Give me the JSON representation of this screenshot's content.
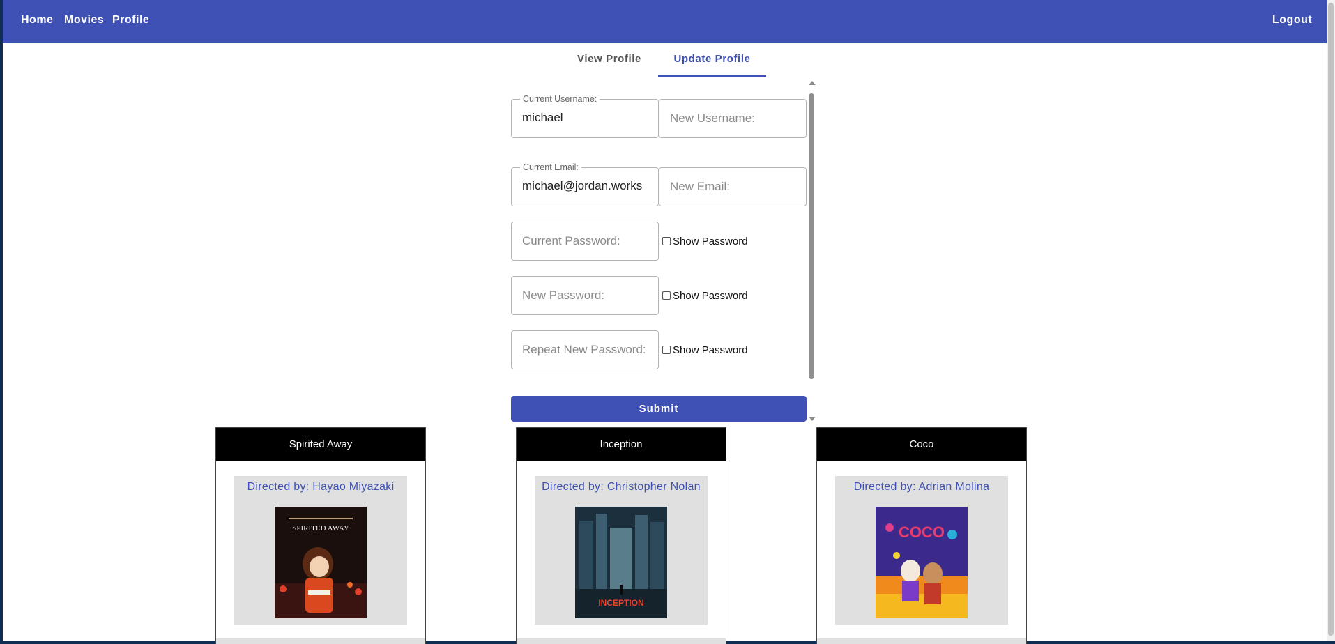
{
  "navbar": {
    "links": [
      "Home",
      "Movies",
      "Profile"
    ],
    "logout": "Logout",
    "color": "#3f51b5"
  },
  "tabs": {
    "view_profile": "View Profile",
    "update_profile": "Update Profile",
    "active": "Update Profile"
  },
  "form": {
    "current_username_label": "Current Username:",
    "current_username_value": "michael",
    "new_username_placeholder": "New Username:",
    "current_email_label": "Current Email:",
    "current_email_value": "michael@jordan.works",
    "new_email_placeholder": "New Email:",
    "current_password_placeholder": "Current Password:",
    "new_password_placeholder": "New Password:",
    "repeat_password_placeholder": "Repeat New Password:",
    "show_password_label": "Show Password",
    "submit_label": "Submit"
  },
  "movies": [
    {
      "title": "Spirited Away",
      "director": "Directed by: Hayao Miyazaki",
      "poster_icon": "spirited-away-poster"
    },
    {
      "title": "Inception",
      "director": "Directed by: Christopher Nolan",
      "poster_icon": "inception-poster"
    },
    {
      "title": "Coco",
      "director": "Directed by: Adrian Molina",
      "poster_icon": "coco-poster"
    }
  ],
  "poster_text": {
    "spirited": "SPIRITED AWAY",
    "inception": "INCEPTION",
    "coco": "COCO"
  }
}
